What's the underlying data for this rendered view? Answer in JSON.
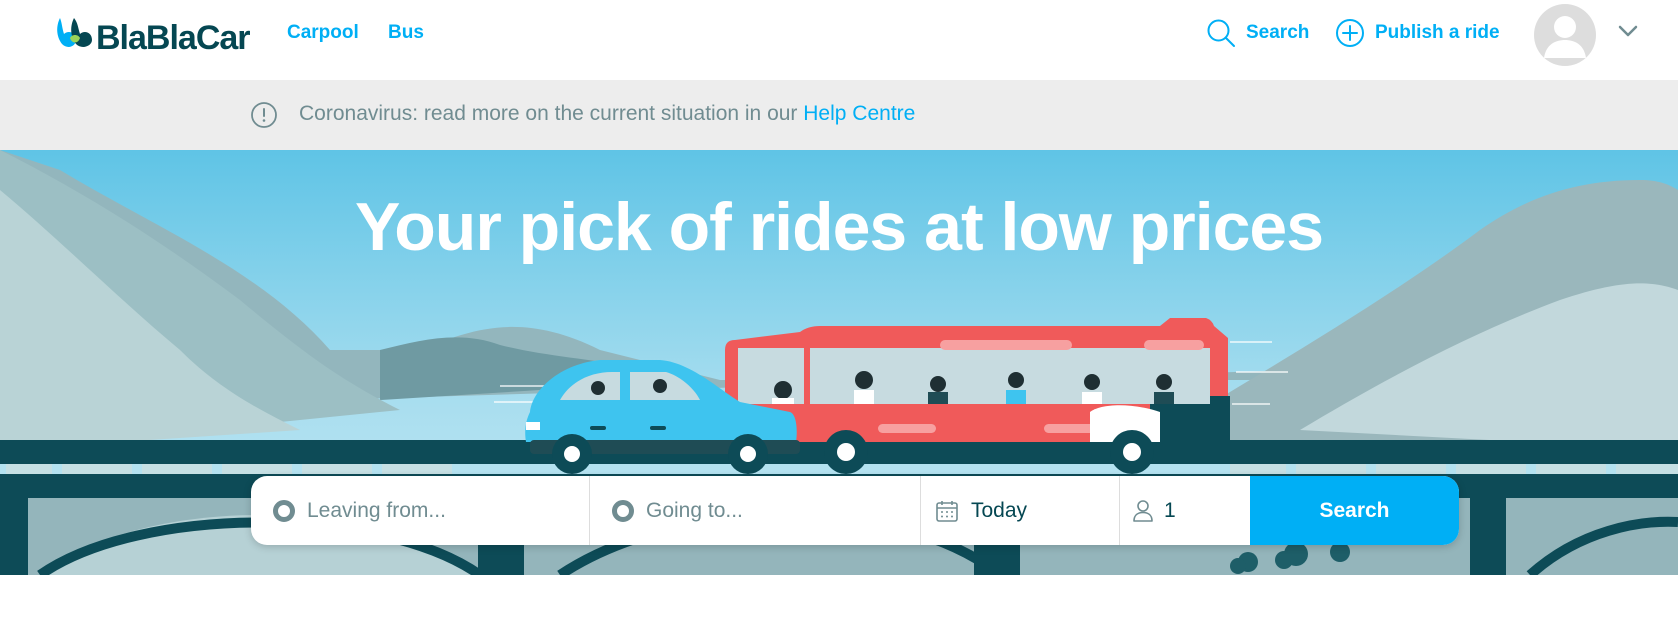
{
  "header": {
    "logo_text": "BlaBlaCar",
    "nav": [
      {
        "label": "Carpool"
      },
      {
        "label": "Bus"
      }
    ],
    "search_label": "Search",
    "publish_label": "Publish a ride"
  },
  "notice": {
    "text": "Coronavirus: read more on the current situation in our ",
    "link_text": "Help Centre"
  },
  "hero": {
    "title": "Your pick of rides at low prices"
  },
  "search": {
    "from_placeholder": "Leaving from...",
    "to_placeholder": "Going to...",
    "date_value": "Today",
    "passengers_value": "1",
    "button_label": "Search"
  },
  "colors": {
    "brand_blue": "#00aff5",
    "brand_dark": "#054752",
    "muted": "#708c91",
    "bus_red": "#f05a5a",
    "car_blue": "#3ec4ef",
    "bridge": "#0d4b57"
  }
}
